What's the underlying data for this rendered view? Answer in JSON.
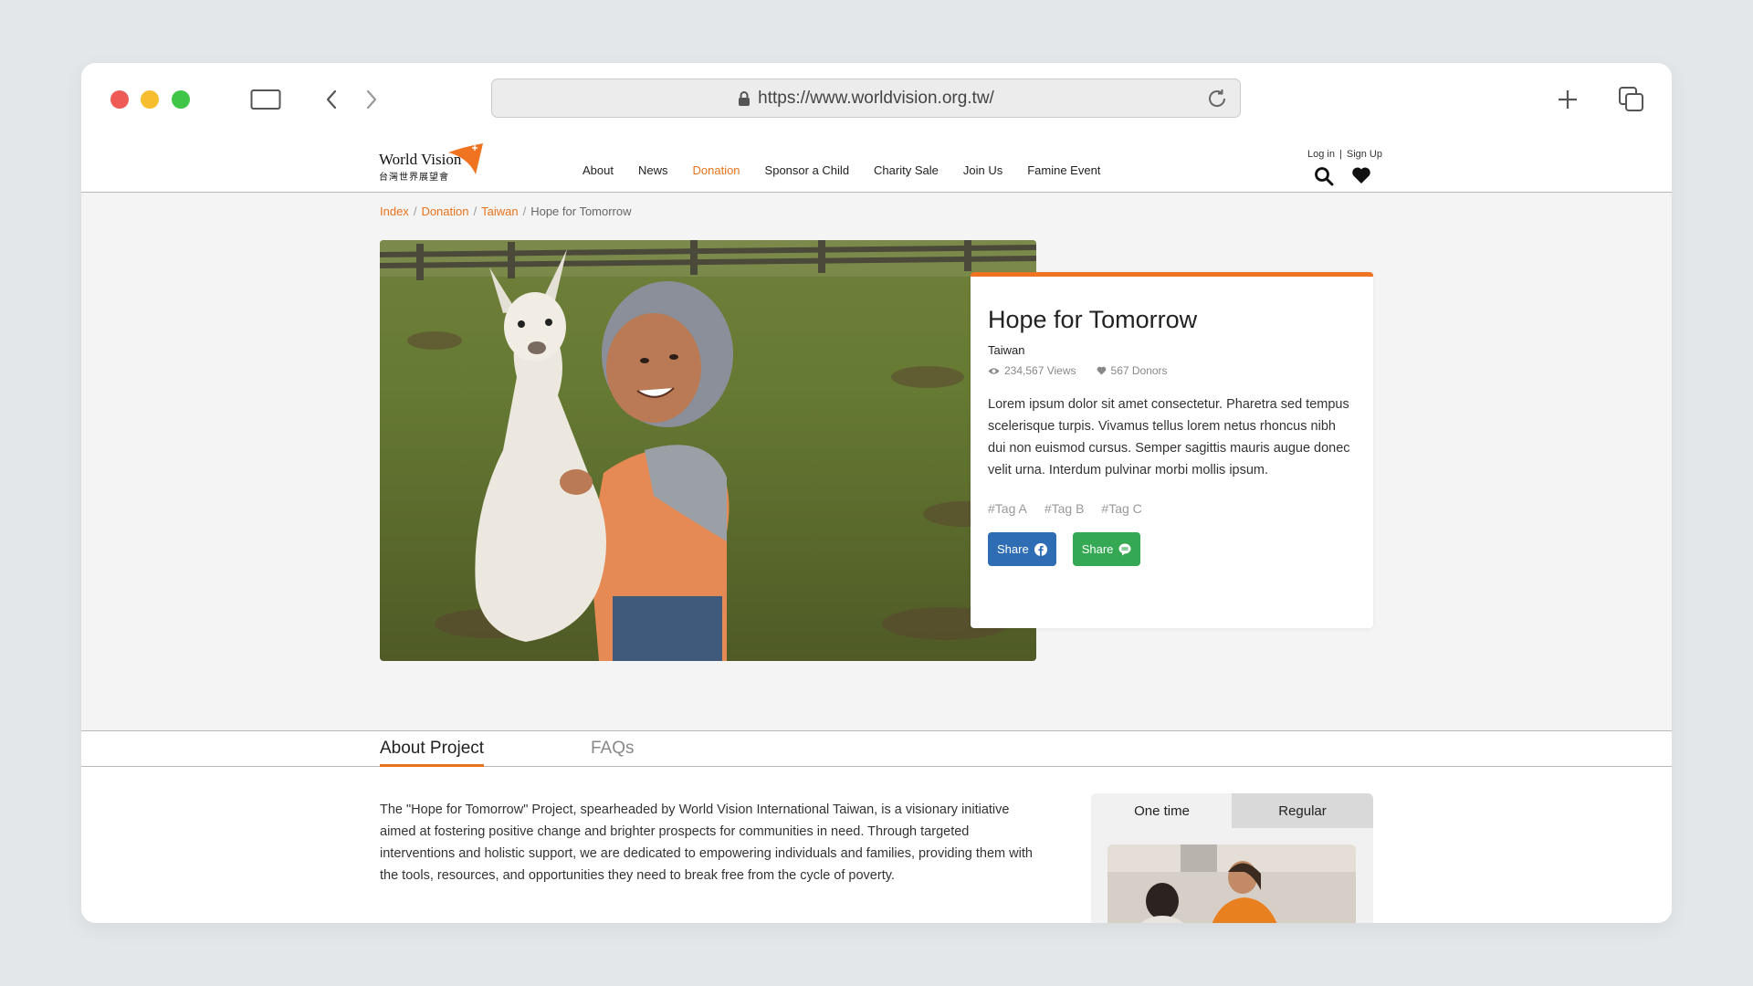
{
  "browser": {
    "url": "https://www.worldvision.org.tw/"
  },
  "header": {
    "logo_en": "World Vision",
    "logo_zh": "台灣世界展望會",
    "nav": [
      {
        "label": "About",
        "active": false
      },
      {
        "label": "News",
        "active": false
      },
      {
        "label": "Donation",
        "active": true
      },
      {
        "label": "Sponsor a Child",
        "active": false
      },
      {
        "label": "Charity Sale",
        "active": false
      },
      {
        "label": "Join Us",
        "active": false
      },
      {
        "label": "Famine Event",
        "active": false
      }
    ],
    "login": "Log in",
    "signup": "Sign Up",
    "auth_separator": "|"
  },
  "breadcrumb": {
    "items": [
      "Index",
      "Donation",
      "Taiwan"
    ],
    "separator": "/",
    "current": "Hope for Tomorrow"
  },
  "project": {
    "title": "Hope for Tomorrow",
    "location": "Taiwan",
    "views": "234,567 Views",
    "donors": "567 Donors",
    "description": "Lorem ipsum dolor sit amet consectetur. Pharetra sed tempus scelerisque turpis. Vivamus tellus lorem netus rhoncus nibh dui non euismod cursus. Semper sagittis mauris augue donec velit urna. Interdum pulvinar morbi mollis ipsum.",
    "tags": [
      "#Tag A",
      "#Tag B",
      "#Tag C"
    ],
    "share_facebook": "Share",
    "share_line": "Share"
  },
  "tabs": {
    "about": "About Project",
    "faqs": "FAQs"
  },
  "about": {
    "text": "The \"Hope for Tomorrow\" Project, spearheaded by World Vision International Taiwan, is a visionary initiative aimed at fostering positive change and brighter prospects for communities in need. Through targeted interventions and holistic support, we are dedicated to empowering individuals and families, providing them with the tools, resources, and opportunities they need to break free from the cycle of poverty."
  },
  "donate": {
    "one_time": "One time",
    "regular": "Regular"
  },
  "colors": {
    "accent": "#e8731b",
    "facebook": "#2e6db4",
    "line": "#34a853"
  }
}
